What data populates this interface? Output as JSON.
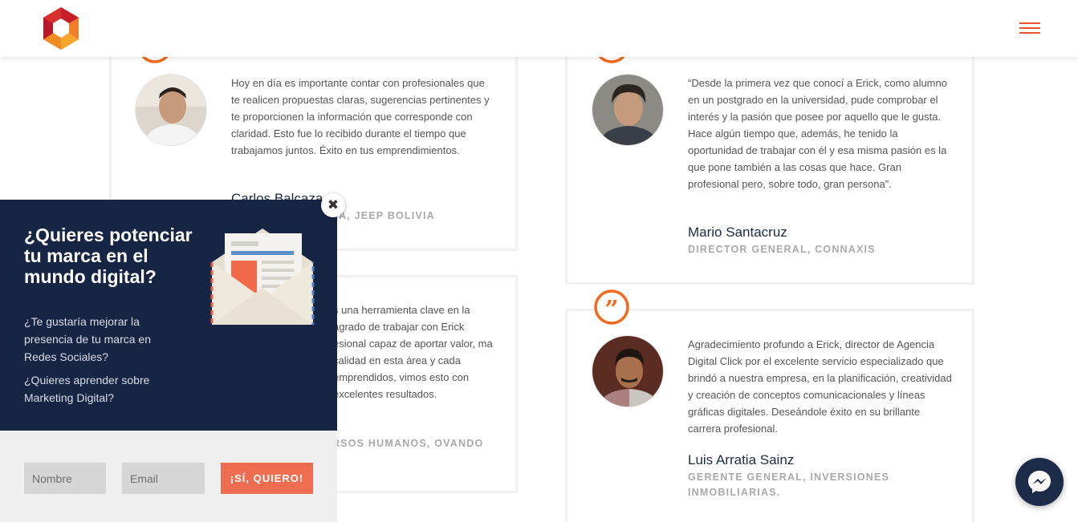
{
  "header": {
    "logo_icon": "hexagon-logo-icon",
    "menu_icon": "hamburger-icon"
  },
  "testimonials": [
    {
      "text": "Hoy en día es importante contar con profesionales que te realicen propuestas claras, sugerencias pertinentes y te proporcionen la información que corresponde con claridad. Esto fue lo recibido durante el tiempo que trabajamos juntos. Éxito en tus emprendimientos.",
      "name": "Carlos Balcaza",
      "role": "A, JEEP BOLIVIA"
    },
    {
      "text": "“Desde la primera vez que conocí a Erick, como alumno en un postgrado en la universidad, pude comprobar el interés y la pasión que posee por aquello que le gusta. Hace algún tiempo que, además, he tenido la oportunidad de trabajar con él y esa misma pasión es la que pone también a las cosas que hace. Gran profesional pero, sobre todo, gran persona”.",
      "name": "Mario Santacruz",
      "role": "DIRECTOR GENERAL, CONNAXIS"
    },
    {
      "text": "s una herramienta clave en la agrado de trabajar con Erick esional capaz de aportar valor, ma calidad en esta área y cada emprendidos, vimos esto con excelentes resultados.",
      "name": "",
      "role": "RSOS HUMANOS, OVANDO"
    },
    {
      "text": "Agradecimiento profundo a Erick, director de Agencia Digital Click por el excelente servicio especializado que brindó a nuestra empresa, en la planificación, creatividad y creación de conceptos comunicacionales y líneas gráficas digitales. Deseándole éxito en su brillante carrera profesional.",
      "name": "Luis Arratia Sainz",
      "role": "GERENTE GENERAL, INVERSIONES INMOBILIARIAS."
    }
  ],
  "popup": {
    "title": "¿Quieres potenciar tu marca en el mundo digital?",
    "question_1": "¿Te gustaría mejorar la presencia de tu marca en Redes Sociales?",
    "question_2": "¿Quieres aprender sobre Marketing Digital?",
    "close_label": "✖",
    "name_placeholder": "Nombre",
    "email_placeholder": "Email",
    "submit_label": "¡SÍ, QUIERO!"
  },
  "colors": {
    "accent": "#ee6c4f",
    "navy": "#172544",
    "quote": "#f26a1b"
  }
}
